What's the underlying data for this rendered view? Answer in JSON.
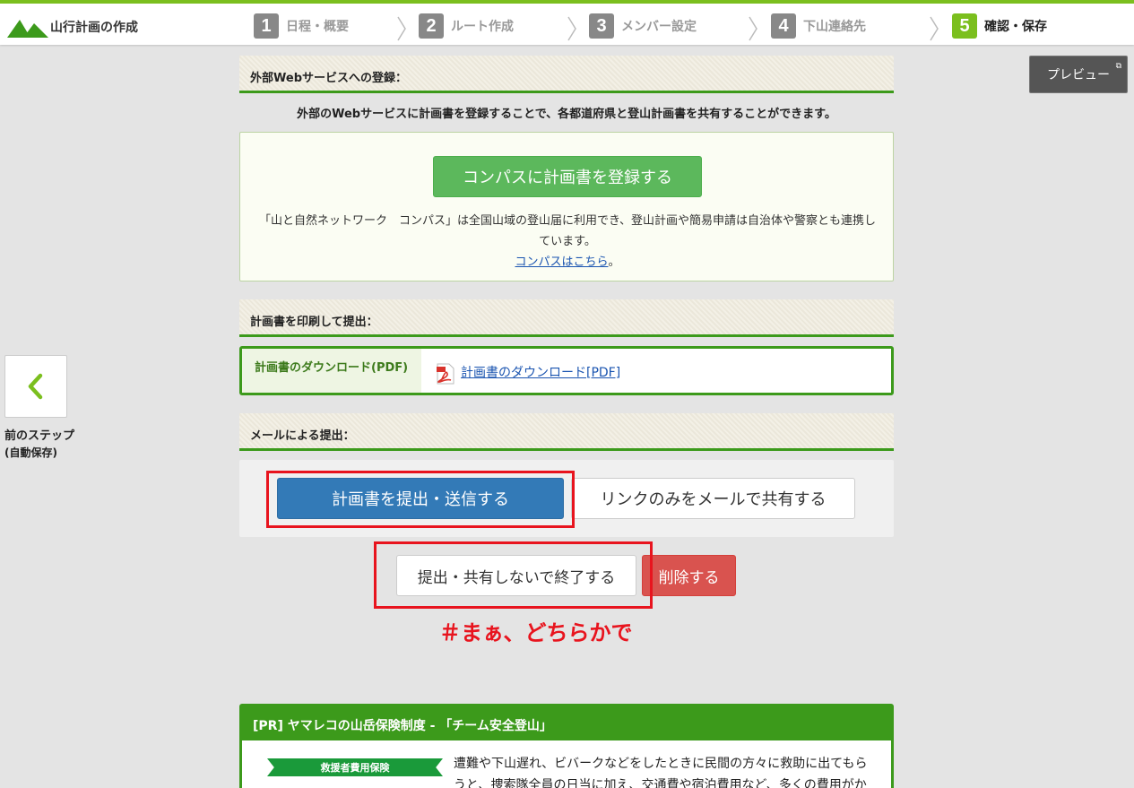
{
  "header": {
    "app_title": "山行計画の作成",
    "steps": [
      {
        "num": "1",
        "label": "日程・概要"
      },
      {
        "num": "2",
        "label": "ルート作成"
      },
      {
        "num": "3",
        "label": "メンバー設定"
      },
      {
        "num": "4",
        "label": "下山連絡先"
      },
      {
        "num": "5",
        "label": "確認・保存",
        "active": true
      }
    ]
  },
  "preview_label": "プレビュー",
  "prev_step": {
    "label": "前のステップ",
    "sub": "(自動保存)"
  },
  "external": {
    "header": "外部Webサービスへの登録：",
    "intro": "外部のWebサービスに計画書を登録することで、各都道府県と登山計画書を共有することができます。",
    "compass_button": "コンパスに計画書を登録する",
    "compass_desc": "「山と自然ネットワーク　コンパス」は全国山域の登山届に利用でき、登山計画や簡易申請は自治体や警察とも連携しています。",
    "compass_link": "コンパスはこちら",
    "compass_link_suffix": "。"
  },
  "print": {
    "header": "計画書を印刷して提出：",
    "pdf_label": "計画書のダウンロード(PDF)",
    "pdf_link": "計画書のダウンロード[PDF]"
  },
  "mail": {
    "header": "メールによる提出：",
    "submit_button": "計画書を提出・送信する",
    "share_button": "リンクのみをメールで共有する"
  },
  "actions": {
    "finish_button": "提出・共有しないで終了する",
    "delete_button": "削除する"
  },
  "annotation": "＃まぁ、どちらかで",
  "pr": {
    "header": "[PR] ヤマレコの山岳保険制度 - 「チーム安全登山」",
    "badge": "救援者費用保険",
    "text": "遭難や下山遅れ、ビバークなどをしたときに民間の方々に救助に出てもらうと、捜索隊全員の日当に加え、交通費や宿泊費用など、多くの費用がかかります。"
  },
  "colors": {
    "brand_green": "#7bbf1e",
    "section_green": "#3c9a1b",
    "primary_blue": "#337ab7",
    "success_green": "#5cb85c",
    "danger_red": "#d9534f",
    "annotation_red": "#e8141e"
  }
}
